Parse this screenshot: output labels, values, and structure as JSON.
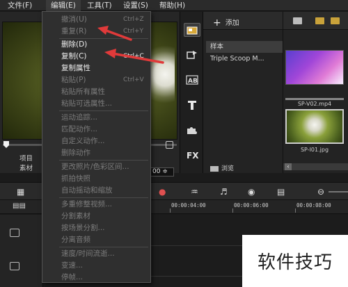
{
  "menubar": {
    "file": "文件(F)",
    "edit": "编辑(E)",
    "tools": "工具(T)",
    "settings": "设置(S)",
    "help": "帮助(H)"
  },
  "preview": {
    "project_label": "项目",
    "clip_label": "素材",
    "timecode_suffix": "00 ≑"
  },
  "library": {
    "add_label": "添加",
    "items": [
      "样本",
      "Triple Scoop M..."
    ],
    "browse_label": "浏览",
    "thumbnails": [
      {
        "name": "SP-V02.mp4"
      },
      {
        "name": "SP-I01.jpg"
      }
    ]
  },
  "timeline": {
    "ruler_labels": [
      "00:00:04:00",
      "00:00:06:00",
      "00:00:08:00"
    ]
  },
  "edit_menu": {
    "items": [
      {
        "label": "撤消(U)",
        "shortcut": "Ctrl+Z",
        "enabled": false
      },
      {
        "label": "重复(R)",
        "shortcut": "Ctrl+Y",
        "enabled": false
      },
      {
        "label": "删除(D)",
        "shortcut": "",
        "enabled": true
      },
      {
        "label": "复制(C)",
        "shortcut": "Ctrl+C",
        "enabled": true
      },
      {
        "label": "复制属性",
        "shortcut": "",
        "enabled": true
      },
      {
        "label": "粘贴(P)",
        "shortcut": "Ctrl+V",
        "enabled": false
      },
      {
        "label": "粘贴所有属性",
        "shortcut": "",
        "enabled": false
      },
      {
        "label": "粘贴可选属性...",
        "shortcut": "",
        "enabled": false
      },
      {
        "label": "运动追踪...",
        "shortcut": "",
        "enabled": false
      },
      {
        "label": "匹配动作...",
        "shortcut": "",
        "enabled": false
      },
      {
        "label": "自定义动作...",
        "shortcut": "",
        "enabled": false
      },
      {
        "label": "删除动作",
        "shortcut": "",
        "enabled": false
      },
      {
        "label": "更改照片/色彩区间...",
        "shortcut": "",
        "enabled": false
      },
      {
        "label": "抓拍快照",
        "shortcut": "",
        "enabled": false
      },
      {
        "label": "自动摇动和缩放",
        "shortcut": "",
        "enabled": false
      },
      {
        "label": "多重修整视频...",
        "shortcut": "",
        "enabled": false
      },
      {
        "label": "分割素材",
        "shortcut": "",
        "enabled": false
      },
      {
        "label": "按场景分割...",
        "shortcut": "",
        "enabled": false
      },
      {
        "label": "分离音频",
        "shortcut": "",
        "enabled": false
      },
      {
        "label": "速度/时间流逝...",
        "shortcut": "",
        "enabled": false
      },
      {
        "label": "变速...",
        "shortcut": "",
        "enabled": false
      },
      {
        "label": "停帧...",
        "shortcut": "",
        "enabled": false
      }
    ]
  },
  "annotations": {
    "arrow_color": "#e03a3a"
  },
  "watermark": {
    "text": "软件技巧"
  }
}
